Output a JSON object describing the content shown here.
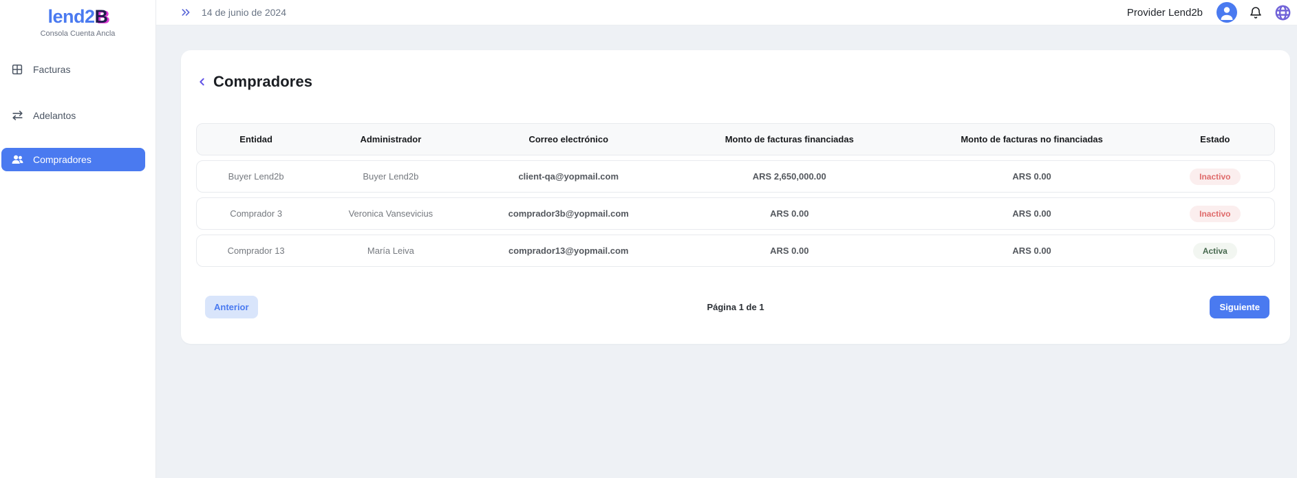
{
  "brand": {
    "logo_primary": "lend2",
    "logo_accent": "B",
    "subtitle": "Consola Cuenta Ancla"
  },
  "sidebar": {
    "items": [
      {
        "label": "Facturas",
        "icon": "table-icon",
        "active": false
      },
      {
        "label": "Adelantos",
        "icon": "transfer-arrows-icon",
        "active": false
      },
      {
        "label": "Compradores",
        "icon": "users-icon",
        "active": true
      }
    ]
  },
  "topbar": {
    "date": "14 de junio de 2024",
    "user_label": "Provider Lend2b",
    "icons": [
      "chevrons-right-icon",
      "avatar-icon",
      "bell-icon",
      "globe-icon"
    ]
  },
  "page": {
    "title": "Compradores",
    "back_icon": "chevron-left-icon"
  },
  "table": {
    "columns": [
      "Entidad",
      "Administrador",
      "Correo electrónico",
      "Monto de facturas financiadas",
      "Monto de facturas no financiadas",
      "Estado"
    ],
    "rows": [
      {
        "entidad": "Buyer Lend2b",
        "administrador": "Buyer Lend2b",
        "correo": "client-qa@yopmail.com",
        "monto_financiadas": "ARS 2,650,000.00",
        "monto_no_financiadas": "ARS 0.00",
        "estado": "Inactivo",
        "estado_tipo": "inactive"
      },
      {
        "entidad": "Comprador 3",
        "administrador": "Veronica Vansevicius",
        "correo": "comprador3b@yopmail.com",
        "monto_financiadas": "ARS 0.00",
        "monto_no_financiadas": "ARS 0.00",
        "estado": "Inactivo",
        "estado_tipo": "inactive"
      },
      {
        "entidad": "Comprador 13",
        "administrador": "María Leiva",
        "correo": "comprador13@yopmail.com",
        "monto_financiadas": "ARS 0.00",
        "monto_no_financiadas": "ARS 0.00",
        "estado": "Activa",
        "estado_tipo": "active"
      }
    ]
  },
  "pagination": {
    "prev": "Anterior",
    "info": "Página 1 de 1",
    "next": "Siguiente"
  },
  "colors": {
    "primary_blue": "#4A7AF0",
    "logo_magenta": "#DC39D4",
    "logo_navy": "#221B4E",
    "page_bg": "#EEF1F5",
    "badge_inactive_bg": "#FBEEEE",
    "badge_inactive_text": "#DF6A6A",
    "badge_active_bg": "#F2F6F1",
    "badge_active_text": "#47694F",
    "indigo_icon": "#5A67D8",
    "globe_purple": "#7163D8"
  }
}
